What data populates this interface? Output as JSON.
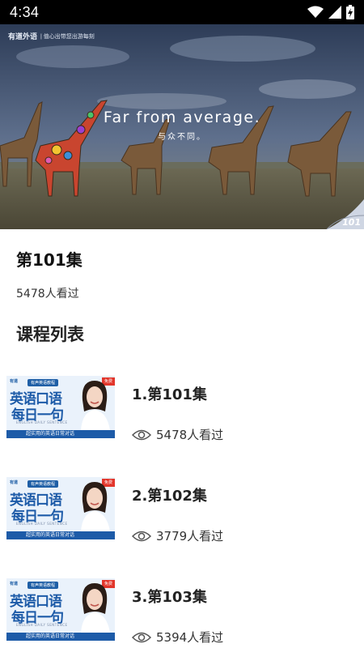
{
  "status_bar": {
    "time": "4:34",
    "icons": [
      "wifi-icon",
      "cellular-signal-icon",
      "battery-charging-icon"
    ]
  },
  "banner": {
    "logo_text": "有道外语",
    "logo_subtext": "| 值心出带您出游每刻",
    "headline": "Far from average.",
    "subheadline": "与众不同。",
    "corner_number": "101"
  },
  "episode": {
    "title": "第101集",
    "views": "5478人看过"
  },
  "course_section": {
    "title": "课程列表"
  },
  "thumbnail": {
    "logo": "有道",
    "top_tag": "有声英语教程",
    "badge": "免费",
    "line1": "英语口语",
    "line2": "每日一句",
    "english": "ENGLISH DAILY SENTENCE",
    "bottom": "超实用的英语日常对话"
  },
  "courses": [
    {
      "title": "1.第101集",
      "views": "5478人看过"
    },
    {
      "title": "2.第102集",
      "views": "3779人看过"
    },
    {
      "title": "3.第103集",
      "views": "5394人看过"
    }
  ],
  "colors": {
    "status_bar": "#000000",
    "accent_blue": "#1d5ba8",
    "badge_red": "#e2362b"
  }
}
